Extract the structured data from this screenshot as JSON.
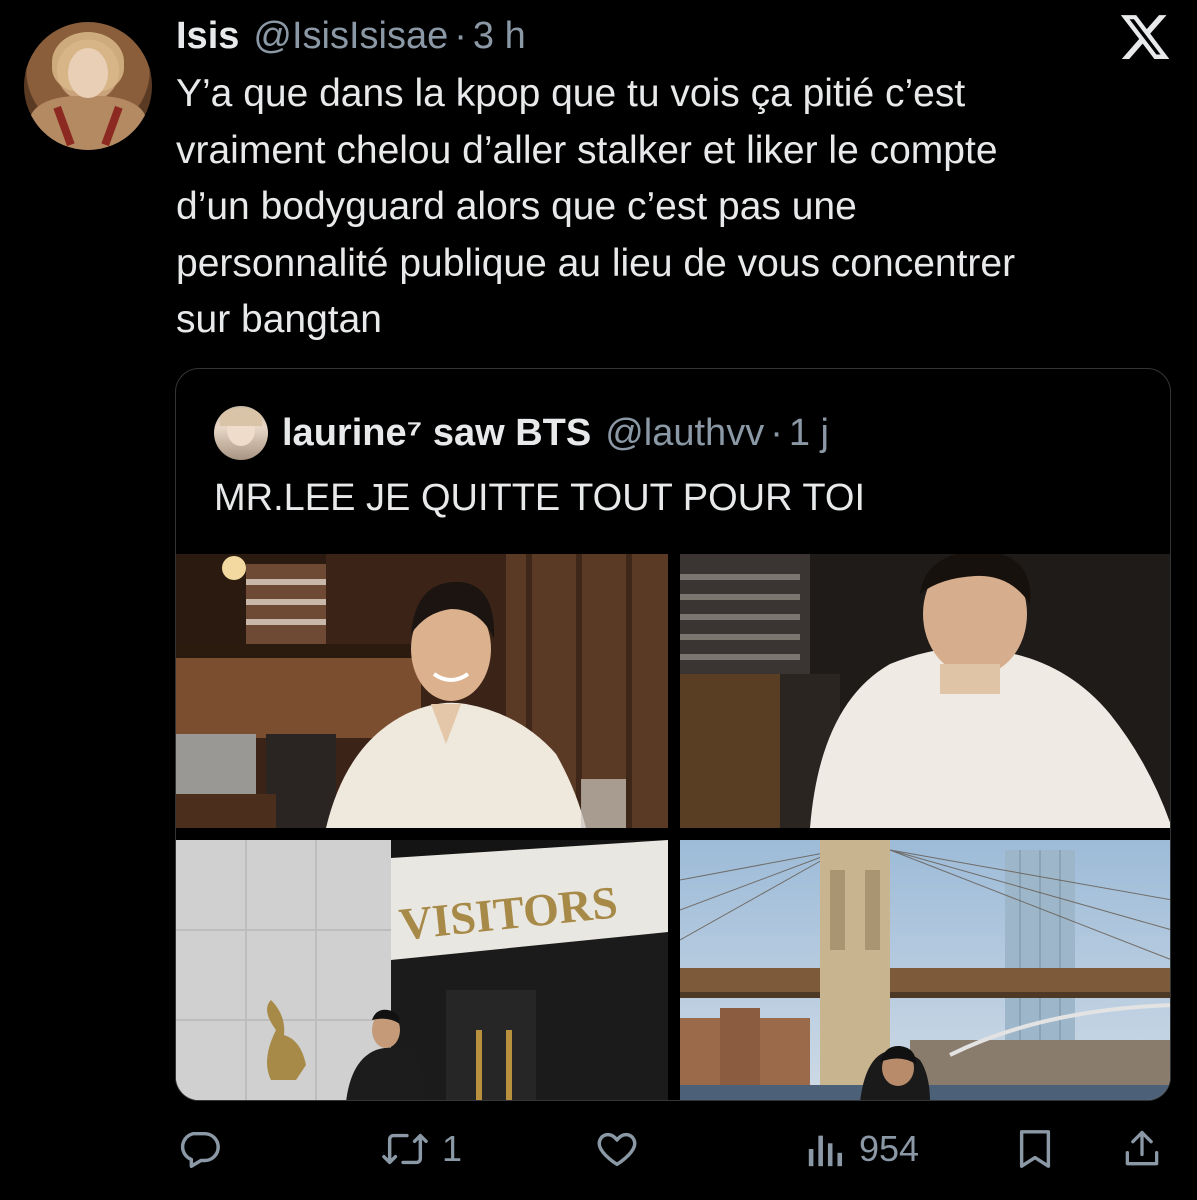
{
  "tweet": {
    "author_name": "Isis",
    "author_handle": "@IsisIsisae",
    "separator": "·",
    "time": "3 h",
    "text_lines": [
      "Y’a que dans la kpop que tu vois ça pitié c’est",
      "vraiment chelou d’aller stalker et liker le compte",
      "d’un bodyguard  alors que c’est pas une",
      "personnalité publique au lieu de vous concentrer",
      "sur bangtan"
    ]
  },
  "quote": {
    "author_name": "laurine⁷ saw BTS",
    "author_handle": "@lauthvv",
    "separator": "·",
    "time": "1 j",
    "text": "MR.LEE JE QUITTE TOUT POUR TOI",
    "media_sign_text": "VISITORS"
  },
  "actions": {
    "reply_count": "",
    "retweet_count": "1",
    "like_count": "",
    "views_count": "954"
  },
  "icons": {
    "logo": "x-logo-icon",
    "reply": "reply-icon",
    "retweet": "retweet-icon",
    "like": "heart-icon",
    "views": "views-icon",
    "bookmark": "bookmark-icon",
    "share": "share-icon"
  },
  "colors": {
    "background": "#000000",
    "text": "#e7e9ea",
    "secondary": "#8b98a5",
    "border": "#333639"
  }
}
